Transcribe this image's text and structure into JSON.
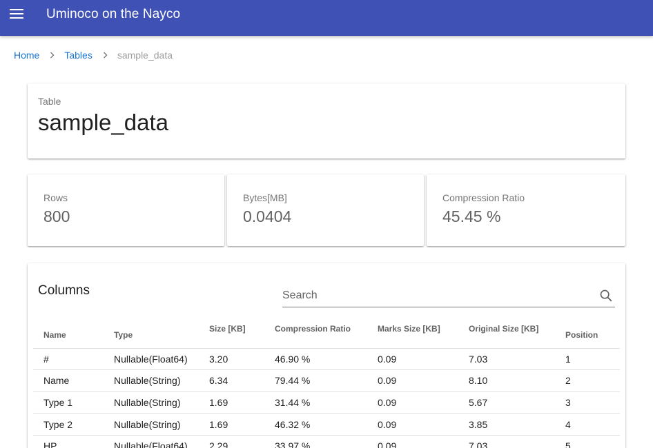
{
  "app": {
    "title": "Uminoco on the Nayco",
    "menu_icon": "hamburger-menu-icon",
    "bar_color": "#3f51b5"
  },
  "breadcrumb": {
    "items": [
      {
        "label": "Home"
      },
      {
        "label": "Tables"
      }
    ],
    "current": "sample_data",
    "separator_icon": "chevron-right-icon"
  },
  "table_card": {
    "overline": "Table",
    "name": "sample_data"
  },
  "stats": [
    {
      "label": "Rows",
      "value": "800"
    },
    {
      "label": "Bytes[MB]",
      "value": "0.0404"
    },
    {
      "label": "Compression Ratio",
      "value": "45.45 %"
    }
  ],
  "columns_card": {
    "title": "Columns",
    "search": {
      "placeholder": "Search",
      "value": "",
      "icon": "search-icon"
    },
    "headers": [
      "Name",
      "Type",
      "Size [KB]",
      "Compression Ratio",
      "Marks Size [KB]",
      "Original Size [KB]",
      "Position"
    ],
    "rows": [
      {
        "name": "#",
        "type": "Nullable(Float64)",
        "size": "3.20",
        "compression": "46.90 %",
        "marks": "0.09",
        "original": "7.03",
        "position": "1"
      },
      {
        "name": "Name",
        "type": "Nullable(String)",
        "size": "6.34",
        "compression": "79.44 %",
        "marks": "0.09",
        "original": "8.10",
        "position": "2"
      },
      {
        "name": "Type 1",
        "type": "Nullable(String)",
        "size": "1.69",
        "compression": "31.44 %",
        "marks": "0.09",
        "original": "5.67",
        "position": "3"
      },
      {
        "name": "Type 2",
        "type": "Nullable(String)",
        "size": "1.69",
        "compression": "46.32 %",
        "marks": "0.09",
        "original": "3.85",
        "position": "4"
      },
      {
        "name": "HP",
        "type": "Nullable(Float64)",
        "size": "2.29",
        "compression": "33.97 %",
        "marks": "0.09",
        "original": "7.03",
        "position": "5"
      }
    ]
  }
}
